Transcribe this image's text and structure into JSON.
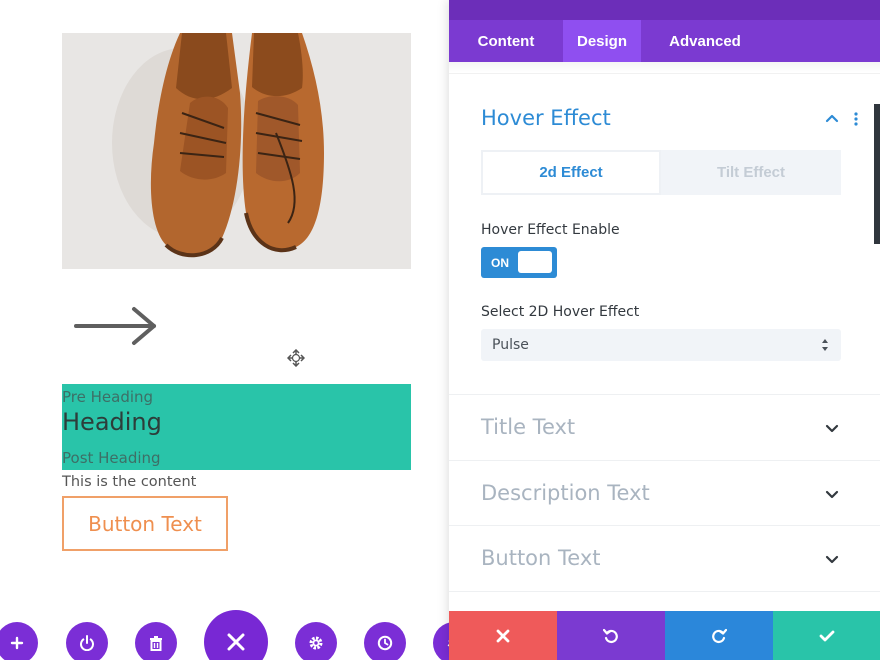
{
  "preview": {
    "image_alt": "brown leather shoes",
    "heading_module": {
      "pre_heading": "Pre Heading",
      "heading": "Heading",
      "post_heading": "Post Heading",
      "content": "This is the content",
      "button_label": "Button Text"
    },
    "toolbar_icons": [
      "add-icon",
      "power-icon",
      "trash-icon",
      "close-icon",
      "gear-icon",
      "history-icon",
      "layers-icon"
    ]
  },
  "panel": {
    "tabs": [
      {
        "label": "Content"
      },
      {
        "label": "Design"
      },
      {
        "label": "Advanced"
      }
    ],
    "active_tab": "Design",
    "hover_effect": {
      "title": "Hover Effect",
      "effect_tabs": [
        "2d Effect",
        "Tilt Effect"
      ],
      "enable_label": "Hover Effect Enable",
      "toggle_label": "ON",
      "select_label": "Select 2D Hover Effect",
      "select_value": "Pulse"
    },
    "sections": [
      {
        "title": "Title Text"
      },
      {
        "title": "Description Text"
      },
      {
        "title": "Button Text"
      }
    ],
    "footer_icons": [
      "discard-icon",
      "undo-icon",
      "redo-icon",
      "save-check-icon"
    ]
  },
  "colors": {
    "purple": "#7b3ad1",
    "accent_blue": "#2d8bd5",
    "teal": "#29c4a9",
    "red": "#ef5a5a",
    "orange": "#ef8f4f"
  }
}
